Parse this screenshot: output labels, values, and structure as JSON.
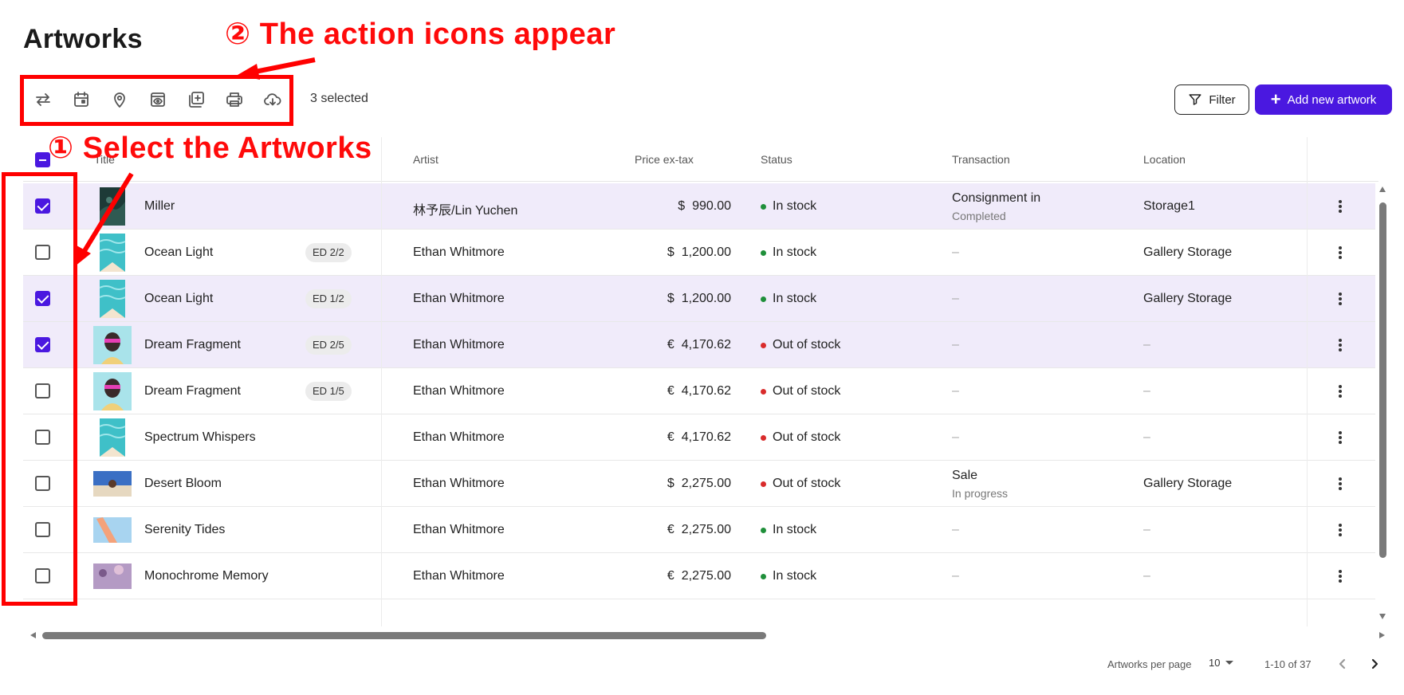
{
  "page": {
    "title": "Artworks"
  },
  "toolbar": {
    "icons": [
      "transfer-icon",
      "calendar-icon",
      "location-pin-icon",
      "preview-icon",
      "add-to-collection-icon",
      "print-icon",
      "cloud-download-icon"
    ],
    "selected_text": "3 selected",
    "filter_label": "Filter",
    "add_label": "Add new artwork"
  },
  "table": {
    "headers": {
      "title": "Title",
      "artist": "Artist",
      "price": "Price ex-tax",
      "status": "Status",
      "transaction": "Transaction",
      "location": "Location"
    },
    "rows": [
      {
        "checked": true,
        "title": "Miller",
        "edition": "",
        "artist": "林予辰/Lin Yuchen",
        "currency": "$",
        "price": "990.00",
        "status": "In stock",
        "status_color": "#1f8f3a",
        "tx_main": "Consignment in",
        "tx_sub": "Completed",
        "location": "Storage1",
        "thumb": "dark-forest"
      },
      {
        "checked": false,
        "title": "Ocean Light",
        "edition": "ED 2/2",
        "artist": "Ethan Whitmore",
        "currency": "$",
        "price": "1,200.00",
        "status": "In stock",
        "status_color": "#1f8f3a",
        "tx_main": "–",
        "tx_sub": "",
        "location": "Gallery Storage",
        "thumb": "ocean"
      },
      {
        "checked": true,
        "title": "Ocean Light",
        "edition": "ED 1/2",
        "artist": "Ethan Whitmore",
        "currency": "$",
        "price": "1,200.00",
        "status": "In stock",
        "status_color": "#1f8f3a",
        "tx_main": "–",
        "tx_sub": "",
        "location": "Gallery Storage",
        "thumb": "ocean"
      },
      {
        "checked": true,
        "title": "Dream Fragment",
        "edition": "ED 2/5",
        "artist": "Ethan Whitmore",
        "currency": "€",
        "price": "4,170.62",
        "status": "Out of stock",
        "status_color": "#d92b2b",
        "tx_main": "–",
        "tx_sub": "",
        "location": "–",
        "thumb": "portrait"
      },
      {
        "checked": false,
        "title": "Dream Fragment",
        "edition": "ED 1/5",
        "artist": "Ethan Whitmore",
        "currency": "€",
        "price": "4,170.62",
        "status": "Out of stock",
        "status_color": "#d92b2b",
        "tx_main": "–",
        "tx_sub": "",
        "location": "–",
        "thumb": "portrait"
      },
      {
        "checked": false,
        "title": "Spectrum Whispers",
        "edition": "",
        "artist": "Ethan Whitmore",
        "currency": "€",
        "price": "4,170.62",
        "status": "Out of stock",
        "status_color": "#d92b2b",
        "tx_main": "–",
        "tx_sub": "",
        "location": "–",
        "thumb": "ocean"
      },
      {
        "checked": false,
        "title": "Desert Bloom",
        "edition": "",
        "artist": "Ethan Whitmore",
        "currency": "$",
        "price": "2,275.00",
        "status": "Out of stock",
        "status_color": "#d92b2b",
        "tx_main": "Sale",
        "tx_sub": "In progress",
        "location": "Gallery Storage",
        "thumb": "beach"
      },
      {
        "checked": false,
        "title": "Serenity Tides",
        "edition": "",
        "artist": "Ethan Whitmore",
        "currency": "€",
        "price": "2,275.00",
        "status": "In stock",
        "status_color": "#1f8f3a",
        "tx_main": "–",
        "tx_sub": "",
        "location": "–",
        "thumb": "pastel"
      },
      {
        "checked": false,
        "title": "Monochrome Memory",
        "edition": "",
        "artist": "Ethan Whitmore",
        "currency": "€",
        "price": "2,275.00",
        "status": "In stock",
        "status_color": "#1f8f3a",
        "tx_main": "–",
        "tx_sub": "",
        "location": "–",
        "thumb": "flowers"
      }
    ]
  },
  "pagination": {
    "per_page_label": "Artworks per page",
    "per_page_value": "10",
    "range_text": "1-10 of 37"
  },
  "annotations": {
    "step1": "① Select the Artworks",
    "step2": "② The action icons appear"
  },
  "colors": {
    "accent": "#4a18e0",
    "annotation": "#ff0000",
    "selected_row": "#f0ebfa"
  }
}
